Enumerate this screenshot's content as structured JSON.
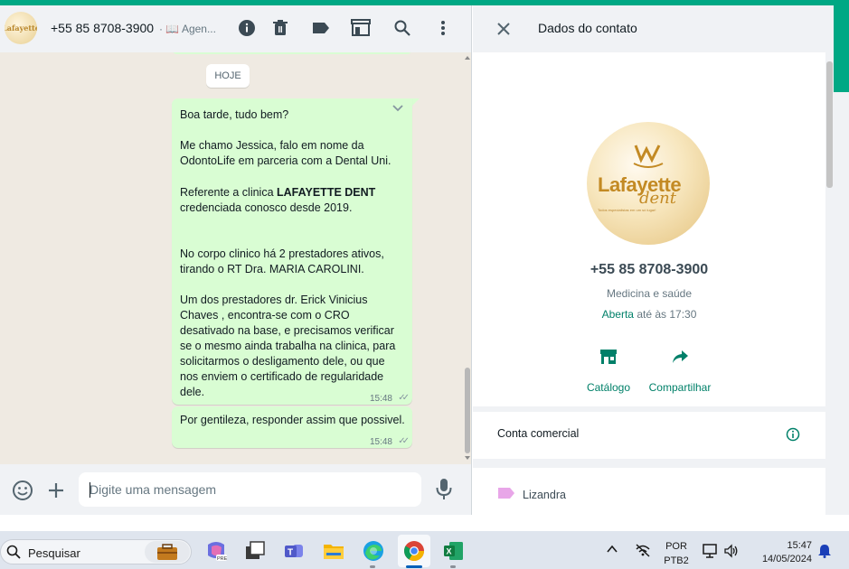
{
  "chat": {
    "header": {
      "title": "+55 85 8708-3900",
      "subtitle": "· 📖 Agen...",
      "avatar_text": "Lafayette"
    },
    "icons": [
      "info-icon",
      "trash-icon",
      "label-icon",
      "catalog-icon",
      "search-icon",
      "menu-icon"
    ],
    "date_chip": "HOJE",
    "messages": [
      {
        "lines": [
          "Boa tarde, tudo bem?",
          "",
          "Me chamo Jessica, falo em nome da",
          "OdontoLife em parceria com a Dental Uni.",
          "",
          "Referente a clinica  LAFAYETTE DENT",
          "credenciada conosco desde 2019.",
          "",
          "",
          "No corpo clinico há 2 prestadores ativos,",
          "tirando o RT Dra. MARIA CAROLINI.",
          "",
          "Um dos prestadores dr.  Erick Vinicius",
          "Chaves  , encontra-se com o CRO",
          "desativado na base, e precisamos verificar",
          "se o mesmo ainda trabalha na clinica, para",
          "solicitarmos o desligamento dele, ou que",
          "nos enviem o certificado de regularidade",
          "dele."
        ],
        "bold_prefix": "Referente a clinica  ",
        "bold_text": "LAFAYETTE DENT",
        "time": "15:48",
        "checks": "✓✓"
      },
      {
        "lines": [
          "Por gentileza, responder assim que possivel."
        ],
        "time": "15:48",
        "checks": "✓✓"
      }
    ],
    "compose": {
      "placeholder": "Digite uma mensagem"
    }
  },
  "contact_info": {
    "title": "Dados do contato",
    "logo_word": "Lafayette",
    "logo_script": "dent",
    "logo_tagline": "Todos especialistas em um só lugar!",
    "number": "+55 85 8708-3900",
    "category": "Medicina e saúde",
    "hours_open": "Aberta",
    "hours_rest": " até às 17:30",
    "actions": [
      {
        "label": "Catálogo",
        "icon": "storefront-icon"
      },
      {
        "label": "Compartilhar",
        "icon": "share-icon"
      }
    ],
    "business_label": "Conta comercial",
    "label_name": "Lizandra",
    "label_color": "#e8a6e8"
  },
  "taskbar": {
    "search_label": "Pesquisar",
    "apps": [
      "copilot-icon",
      "task-view-icon",
      "teams-icon",
      "file-explorer-icon",
      "edge-icon",
      "chrome-icon",
      "excel-icon"
    ],
    "lang_line1": "POR",
    "lang_line2": "PTB2",
    "time": "15:47",
    "date": "14/05/2024"
  },
  "colors": {
    "accent": "#00a884",
    "bubble_out": "#d9fdd3",
    "chat_bg": "#efeae2",
    "panel_bg": "#f0f2f5",
    "link_green": "#008069"
  }
}
